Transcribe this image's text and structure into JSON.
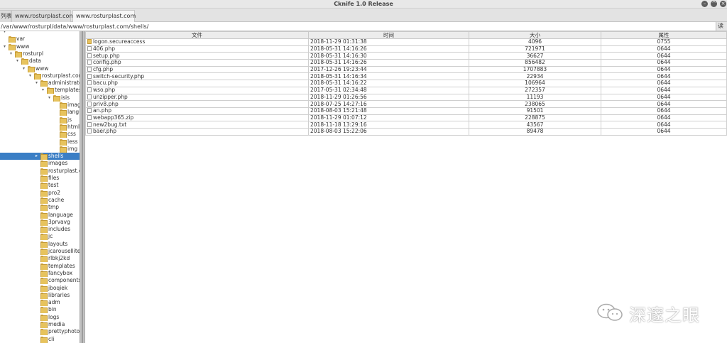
{
  "window": {
    "title": "Cknife 1.0 Release"
  },
  "tabs": [
    {
      "label": "列表"
    },
    {
      "label": "www.rosturplast.com"
    },
    {
      "label": "www.rosturplast.com"
    }
  ],
  "pathbar": {
    "path": "/var/www/rosturpl/data/www/rosturplast.com/shells/",
    "read_label": "读取"
  },
  "tree": [
    {
      "label": "",
      "expander": "▾",
      "selected": false
    },
    {
      "label": "var",
      "expander": "",
      "selected": false
    },
    {
      "label": "www",
      "expander": "▾",
      "selected": false
    },
    {
      "label": "rosturpl",
      "expander": "▾",
      "selected": false
    },
    {
      "label": "data",
      "expander": "▾",
      "selected": false
    },
    {
      "label": "www",
      "expander": "▾",
      "selected": false
    },
    {
      "label": "rosturplast.com",
      "expander": "▾",
      "selected": false
    },
    {
      "label": "administrator",
      "expander": "▾",
      "selected": false
    },
    {
      "label": "templates",
      "expander": "▾",
      "selected": false
    },
    {
      "label": "isis",
      "expander": "▾",
      "selected": false
    },
    {
      "label": "images",
      "expander": "",
      "selected": false
    },
    {
      "label": "language",
      "expander": "",
      "selected": false
    },
    {
      "label": "js",
      "expander": "",
      "selected": false
    },
    {
      "label": "html",
      "expander": "",
      "selected": false
    },
    {
      "label": "css",
      "expander": "",
      "selected": false
    },
    {
      "label": "less",
      "expander": "",
      "selected": false
    },
    {
      "label": "img",
      "expander": "",
      "selected": false
    },
    {
      "label": "shells",
      "expander": "▸",
      "selected": true
    },
    {
      "label": "images",
      "expander": "",
      "selected": false
    },
    {
      "label": "rosturplast.com",
      "expander": "",
      "selected": false
    },
    {
      "label": "files",
      "expander": "",
      "selected": false
    },
    {
      "label": "test",
      "expander": "",
      "selected": false
    },
    {
      "label": "pro2",
      "expander": "",
      "selected": false
    },
    {
      "label": "cache",
      "expander": "",
      "selected": false
    },
    {
      "label": "tmp",
      "expander": "",
      "selected": false
    },
    {
      "label": "language",
      "expander": "",
      "selected": false
    },
    {
      "label": "3prvavg",
      "expander": "",
      "selected": false
    },
    {
      "label": "includes",
      "expander": "",
      "selected": false
    },
    {
      "label": "jc",
      "expander": "",
      "selected": false
    },
    {
      "label": "layouts",
      "expander": "",
      "selected": false
    },
    {
      "label": "jcarousellite",
      "expander": "",
      "selected": false
    },
    {
      "label": "rlbkj2kd",
      "expander": "",
      "selected": false
    },
    {
      "label": "templates",
      "expander": "",
      "selected": false
    },
    {
      "label": "fancybox",
      "expander": "",
      "selected": false
    },
    {
      "label": "components",
      "expander": "",
      "selected": false
    },
    {
      "label": "jboqiek",
      "expander": "",
      "selected": false
    },
    {
      "label": "libraries",
      "expander": "",
      "selected": false
    },
    {
      "label": "adm",
      "expander": "",
      "selected": false
    },
    {
      "label": "bin",
      "expander": "",
      "selected": false
    },
    {
      "label": "logs",
      "expander": "",
      "selected": false
    },
    {
      "label": "media",
      "expander": "",
      "selected": false
    },
    {
      "label": "prettyphoto",
      "expander": "",
      "selected": false
    },
    {
      "label": "cli",
      "expander": "",
      "selected": false
    }
  ],
  "files": {
    "columns": [
      "文件",
      "时间",
      "大小",
      "属性"
    ],
    "rows": [
      {
        "name": "logon.secureaccess",
        "time": "2018-11-29 01:31:38",
        "size": "4096",
        "attr": "0755",
        "is_dir": true
      },
      {
        "name": "406.php",
        "time": "2018-05-31 14:16:26",
        "size": "721971",
        "attr": "0644",
        "is_dir": false
      },
      {
        "name": "setup.php",
        "time": "2018-05-31 14:16:30",
        "size": "36627",
        "attr": "0644",
        "is_dir": false
      },
      {
        "name": "config.php",
        "time": "2018-05-31 14:16:26",
        "size": "856482",
        "attr": "0644",
        "is_dir": false
      },
      {
        "name": "cfg.php",
        "time": "2017-12-26 19:23:44",
        "size": "1707883",
        "attr": "0644",
        "is_dir": false
      },
      {
        "name": "switch-security.php",
        "time": "2018-05-31 14:16:34",
        "size": "22934",
        "attr": "0644",
        "is_dir": false
      },
      {
        "name": "bacu.php",
        "time": "2018-05-31 14:16:22",
        "size": "106964",
        "attr": "0644",
        "is_dir": false
      },
      {
        "name": "wso.php",
        "time": "2017-05-31 02:34:48",
        "size": "272357",
        "attr": "0644",
        "is_dir": false
      },
      {
        "name": "unzipper.php",
        "time": "2018-11-29 01:26:56",
        "size": "11193",
        "attr": "0644",
        "is_dir": false
      },
      {
        "name": "priv8.php",
        "time": "2018-07-25 14:27:16",
        "size": "238065",
        "attr": "0644",
        "is_dir": false
      },
      {
        "name": "an.php",
        "time": "2018-08-03 15:21:48",
        "size": "91501",
        "attr": "0644",
        "is_dir": false
      },
      {
        "name": "webapp365.zip",
        "time": "2018-11-29 01:07:12",
        "size": "228875",
        "attr": "0644",
        "is_dir": false
      },
      {
        "name": "new2bug.txt",
        "time": "2018-11-18 13:29:16",
        "size": "43567",
        "attr": "0644",
        "is_dir": false
      },
      {
        "name": "baer.php",
        "time": "2018-08-03 15:22:06",
        "size": "89478",
        "attr": "0644",
        "is_dir": false
      }
    ]
  },
  "watermark": {
    "text": "深邃之眼"
  },
  "colors": {
    "selection": "#3a7ec5",
    "folder": "#e7c35d",
    "window_bg": "#ededed"
  },
  "icons": {
    "folder": "folder-icon",
    "file": "file-icon",
    "wechat": "wechat-icon"
  }
}
